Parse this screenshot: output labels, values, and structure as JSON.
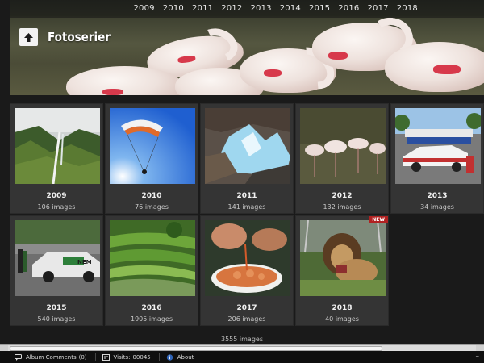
{
  "header": {
    "title": "Fotoserier",
    "years": [
      "2009",
      "2010",
      "2011",
      "2012",
      "2013",
      "2014",
      "2015",
      "2016",
      "2017",
      "2018"
    ]
  },
  "albums": [
    {
      "title": "2009",
      "count": "106 images",
      "scene": "waterfall"
    },
    {
      "title": "2010",
      "count": "76 images",
      "scene": "paraglider"
    },
    {
      "title": "2011",
      "count": "141 images",
      "scene": "glacier"
    },
    {
      "title": "2012",
      "count": "132 images",
      "scene": "flamingos"
    },
    {
      "title": "2013",
      "count": "34 images",
      "scene": "racecar"
    },
    {
      "title": "2015",
      "count": "540 images",
      "scene": "rally"
    },
    {
      "title": "2016",
      "count": "1905 images",
      "scene": "ricefields"
    },
    {
      "title": "2017",
      "count": "206 images",
      "scene": "shrimp"
    },
    {
      "title": "2018",
      "count": "40 images",
      "scene": "lion",
      "badge": "NEW"
    }
  ],
  "total_label": "3555 images",
  "bottom_bar": {
    "comments_label": "Album Comments",
    "comments_count": "(0)",
    "visits_label": "Visits:",
    "visits_count": "00045",
    "about_label": "About",
    "minimize_symbol": "–"
  },
  "colors": {
    "accent_badge": "#b12121",
    "background": "#1a1a1a",
    "card": "#343434"
  }
}
